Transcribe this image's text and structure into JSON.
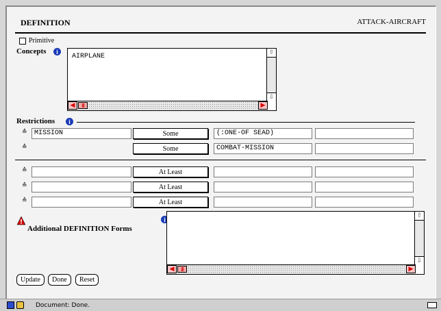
{
  "header": {
    "title": "DEFINITION",
    "concept_name": "ATTACK-AIRCRAFT"
  },
  "primitive": {
    "label": "Primitive",
    "checked": false
  },
  "concepts": {
    "label": "Concepts",
    "value": "AIRPLANE"
  },
  "restrictions": {
    "label": "Restrictions",
    "rows": [
      {
        "role": "MISSION",
        "quantifier": "Some",
        "value": "(:ONE-OF SEAD)",
        "extra": ""
      },
      {
        "role": "",
        "quantifier": "Some",
        "value": "COMBAT-MISSION",
        "extra": ""
      }
    ],
    "blank_rows": [
      {
        "role": "",
        "quantifier": "At Least",
        "value": "",
        "extra": ""
      },
      {
        "role": "",
        "quantifier": "At Least",
        "value": "",
        "extra": ""
      },
      {
        "role": "",
        "quantifier": "At Least",
        "value": "",
        "extra": ""
      }
    ]
  },
  "additional_forms": {
    "label": "Additional DEFINITION Forms",
    "value": ""
  },
  "actions": {
    "update": "Update",
    "done": "Done",
    "reset": "Reset"
  },
  "status": {
    "text": "Document: Done."
  },
  "colors": {
    "info_blue": "#1a3bb7",
    "warning_red": "#d40000",
    "scroll_red": "#f1a9a9"
  },
  "icons": [
    "info-icon",
    "warning-icon",
    "sort-icon",
    "scroll-up-arrow-icon",
    "scroll-down-arrow-icon",
    "scroll-left-arrow-icon",
    "scroll-right-arrow-icon",
    "browser-status-icon",
    "mail-icon"
  ]
}
